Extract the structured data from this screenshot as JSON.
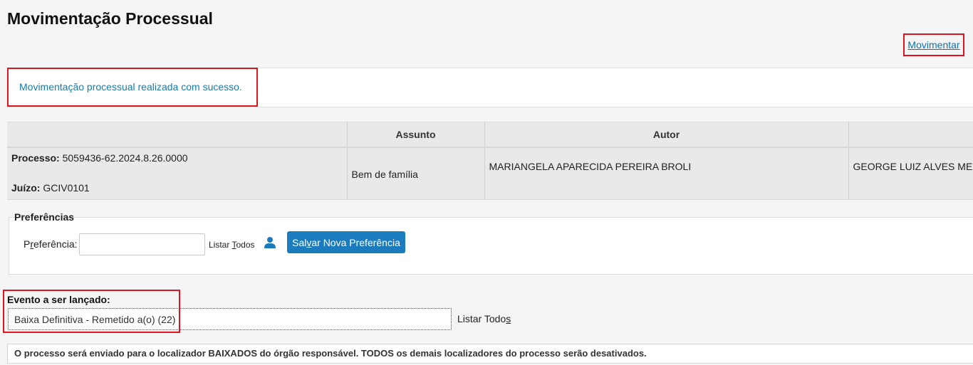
{
  "page": {
    "title": "Movimentação Processual"
  },
  "actions": {
    "movimentar_pre": "M",
    "movimentar_key": "o",
    "movimentar_post": "vimentar"
  },
  "message": {
    "success": "Movimentação processual realizada com sucesso."
  },
  "process_table": {
    "headers": [
      "",
      "Assunto",
      "Autor",
      ""
    ],
    "processo_label": "Processo:",
    "processo_value": "5059436-62.2024.8.26.0000",
    "juizo_label": "Juízo:",
    "juizo_value": "GCIV0101",
    "assunto": "Bem de família",
    "autor": "MARIANGELA APARECIDA PEREIRA BROLI",
    "reu": "GEORGE LUIZ ALVES MEND"
  },
  "preferencias": {
    "legend": "Preferências",
    "label_pre": "P",
    "label_key": "r",
    "label_post": "eferência:",
    "input_value": "",
    "list_pre": "Listar ",
    "list_key": "T",
    "list_post": "odos",
    "save_pre": "Sal",
    "save_key": "v",
    "save_post": "ar Nova Preferência"
  },
  "evento": {
    "label": "Evento a ser lançado:",
    "value": "Baixa Definitiva - Remetido a(o) (22)",
    "list_pre": "Listar Todo",
    "list_key": "s"
  },
  "info": {
    "text": "O processo será enviado para o localizador BAIXADOS do órgão responsável. TODOS os demais localizadores do processo serão desativados."
  },
  "colors": {
    "accent": "#1b7bbd",
    "highlight": "#e0141e",
    "success_text": "#1a7aa8"
  },
  "icons": {
    "user": "user-icon"
  }
}
